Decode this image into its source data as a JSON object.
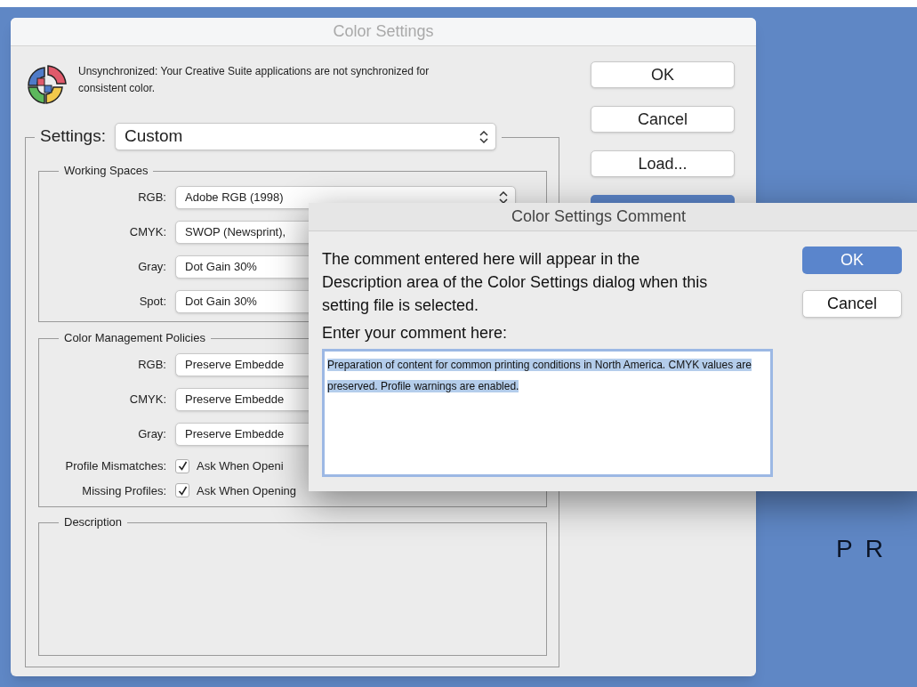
{
  "window": {
    "title": "Color Settings"
  },
  "sync_message": "Unsynchronized: Your Creative Suite applications are not synchronized for consistent color.",
  "settings": {
    "label": "Settings:",
    "value": "Custom"
  },
  "buttons": [
    {
      "label": "OK",
      "kind": "plain"
    },
    {
      "label": "Cancel",
      "kind": "plain"
    },
    {
      "label": "Load...",
      "kind": "plain"
    },
    {
      "kind": "default"
    }
  ],
  "working_spaces": {
    "title": "Working Spaces",
    "rows": [
      {
        "label": "RGB:",
        "value": "Adobe RGB (1998)"
      },
      {
        "label": "CMYK:",
        "value": "SWOP (Newsprint),"
      },
      {
        "label": "Gray:",
        "value": "Dot Gain 30%"
      },
      {
        "label": "Spot:",
        "value": "Dot Gain 30%"
      }
    ]
  },
  "policies": {
    "title": "Color Management Policies",
    "rows": [
      {
        "label": "RGB:",
        "value": "Preserve Embedde"
      },
      {
        "label": "CMYK:",
        "value": "Preserve Embedde"
      },
      {
        "label": "Gray:",
        "value": "Preserve Embedde"
      }
    ],
    "checks": [
      {
        "label": "Profile Mismatches:",
        "option": "Ask When Openi",
        "checked": true
      },
      {
        "label": "Missing Profiles:",
        "option": "Ask When Opening",
        "checked": true
      }
    ]
  },
  "description": {
    "title": "Description"
  },
  "background_text": "PR",
  "comment_dialog": {
    "title": "Color Settings Comment",
    "message": "The comment entered here will appear in the Description area of the Color Settings dialog when this setting file is selected.",
    "prompt": "Enter your comment here:",
    "comment": "Preparation of content for common printing conditions in North America. CMYK values are preserved. Profile warnings are enabled.",
    "buttons": [
      {
        "label": "OK",
        "kind": "default"
      },
      {
        "label": "Cancel",
        "kind": "plain"
      }
    ]
  }
}
